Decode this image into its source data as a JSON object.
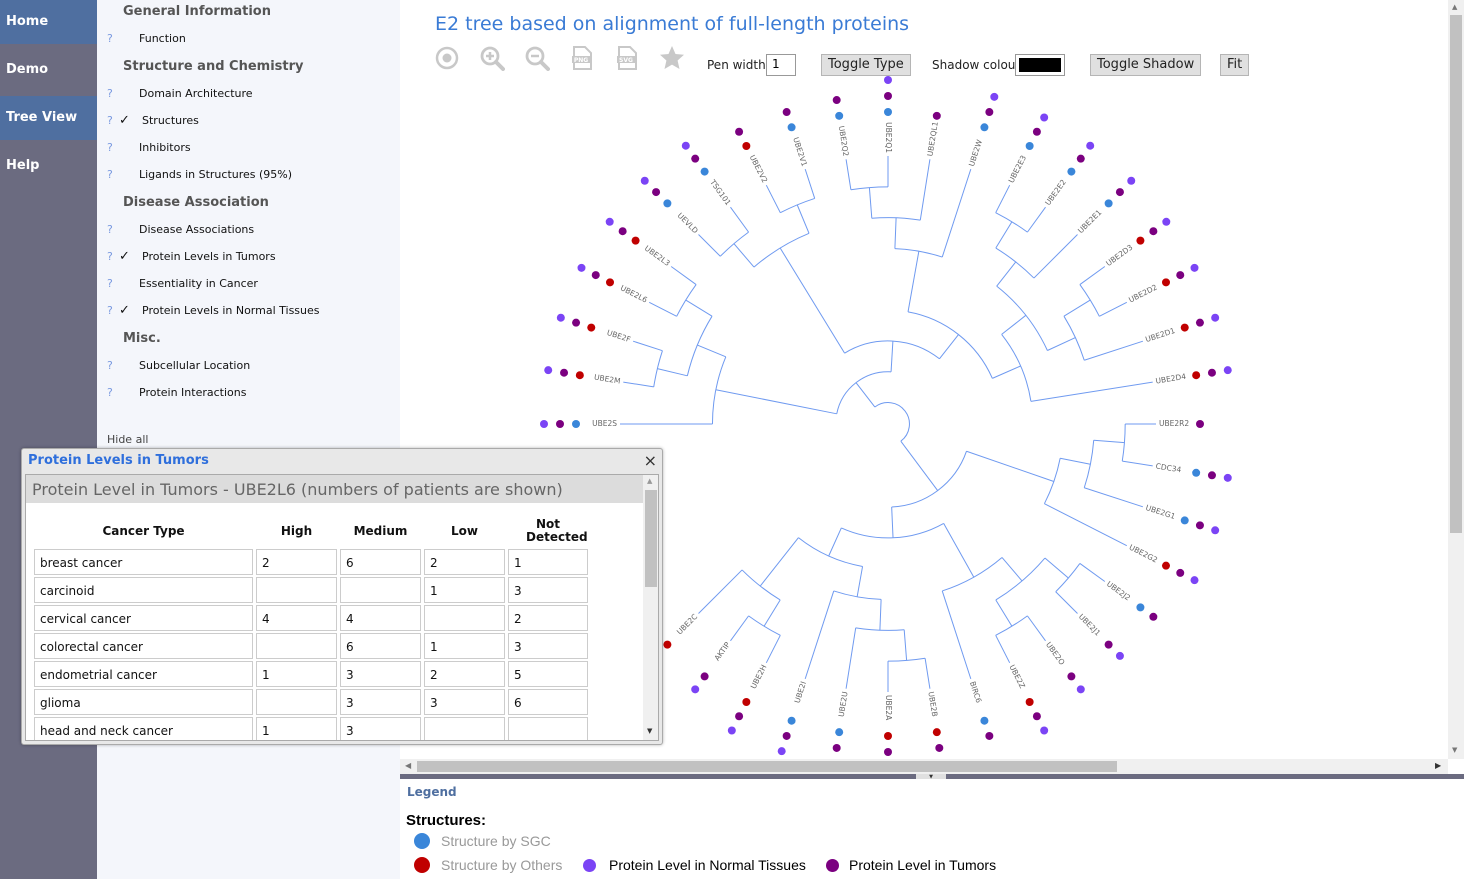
{
  "nav": {
    "items": [
      {
        "label": "Home",
        "active": true
      },
      {
        "label": "Demo",
        "active": false
      },
      {
        "label": "Tree View",
        "active": true
      },
      {
        "label": "Help",
        "active": false
      }
    ]
  },
  "panel": {
    "entries": [
      {
        "type": "section",
        "label": "General Information"
      },
      {
        "type": "item",
        "label": "Function",
        "checked": false
      },
      {
        "type": "section",
        "label": "Structure and Chemistry"
      },
      {
        "type": "item",
        "label": "Domain Architecture",
        "checked": false
      },
      {
        "type": "item",
        "label": "Structures",
        "checked": true
      },
      {
        "type": "item",
        "label": "Inhibitors",
        "checked": false
      },
      {
        "type": "item",
        "label": "Ligands in Structures (95%)",
        "checked": false
      },
      {
        "type": "section",
        "label": "Disease Association"
      },
      {
        "type": "item",
        "label": "Disease Associations",
        "checked": false
      },
      {
        "type": "item",
        "label": "Protein Levels in Tumors",
        "checked": true
      },
      {
        "type": "item",
        "label": "Essentiality in Cancer",
        "checked": false
      },
      {
        "type": "item",
        "label": "Protein Levels in Normal Tissues",
        "checked": true
      },
      {
        "type": "section",
        "label": "Misc."
      },
      {
        "type": "item",
        "label": "Subcellular Location",
        "checked": false
      },
      {
        "type": "item",
        "label": "Protein Interactions",
        "checked": false
      }
    ],
    "help_glyph": "?",
    "check_glyph": "✓",
    "hide_all": "Hide all"
  },
  "main": {
    "title": "E2 tree based on alignment of full-length proteins",
    "toolbar": {
      "icons": [
        "reset-view-icon",
        "zoom-in-icon",
        "zoom-out-icon",
        "export-png-icon",
        "export-svg-icon",
        "favorite-star-icon"
      ],
      "png": "PNG",
      "svg": "SVG",
      "pen_width_label": "Pen width",
      "pen_width": "1",
      "toggle_type": "Toggle Type",
      "shadow_colour_label": "Shadow colour",
      "shadow_colour": "#000000",
      "toggle_shadow": "Toggle Shadow",
      "fit": "Fit"
    }
  },
  "colors": {
    "branch": "#6f9af0",
    "label": "#666666",
    "sgc": "#3a86d9",
    "others": "#c00000",
    "tumor": "#7b0080",
    "normal": "#7b44f5",
    "accent": "#3a7bd5"
  },
  "tree": {
    "leaves": [
      {
        "name": "UBE2S",
        "structure": "sgc",
        "tumor": true,
        "normal": true
      },
      {
        "name": "UBE2M",
        "structure": "others",
        "tumor": true,
        "normal": true
      },
      {
        "name": "UBE2F",
        "structure": "others",
        "tumor": true,
        "normal": true
      },
      {
        "name": "UBE2L6",
        "structure": "others",
        "tumor": true,
        "normal": true
      },
      {
        "name": "UBE2L3",
        "structure": "others",
        "tumor": true,
        "normal": true
      },
      {
        "name": "UEVLD",
        "structure": "sgc",
        "tumor": true,
        "normal": true
      },
      {
        "name": "TSG101",
        "structure": "sgc",
        "tumor": true,
        "normal": true
      },
      {
        "name": "UBE2V2",
        "structure": "others",
        "tumor": true,
        "normal": false
      },
      {
        "name": "UBE2V1",
        "structure": "sgc",
        "tumor": true,
        "normal": false
      },
      {
        "name": "UBE2Q2",
        "structure": "sgc",
        "tumor": true,
        "normal": false
      },
      {
        "name": "UBE2Q1",
        "structure": "sgc",
        "tumor": true,
        "normal": true
      },
      {
        "name": "UBE2QL1",
        "structure": null,
        "tumor": true,
        "normal": false
      },
      {
        "name": "UBE2W",
        "structure": "sgc",
        "tumor": true,
        "normal": true
      },
      {
        "name": "UBE2E3",
        "structure": "sgc",
        "tumor": true,
        "normal": true
      },
      {
        "name": "UBE2E2",
        "structure": "sgc",
        "tumor": true,
        "normal": true
      },
      {
        "name": "UBE2E1",
        "structure": "sgc",
        "tumor": true,
        "normal": true
      },
      {
        "name": "UBE2D3",
        "structure": "others",
        "tumor": true,
        "normal": true
      },
      {
        "name": "UBE2D2",
        "structure": "others",
        "tumor": true,
        "normal": true
      },
      {
        "name": "UBE2D1",
        "structure": "others",
        "tumor": true,
        "normal": true
      },
      {
        "name": "UBE2D4",
        "structure": "others",
        "tumor": true,
        "normal": true
      },
      {
        "name": "UBE2R2",
        "structure": null,
        "tumor": true,
        "normal": false
      },
      {
        "name": "CDC34",
        "structure": "sgc",
        "tumor": true,
        "normal": true
      },
      {
        "name": "UBE2G1",
        "structure": "sgc",
        "tumor": true,
        "normal": true
      },
      {
        "name": "UBE2G2",
        "structure": "others",
        "tumor": true,
        "normal": true
      },
      {
        "name": "UBE2J2",
        "structure": "sgc",
        "tumor": true,
        "normal": false
      },
      {
        "name": "UBE2J1",
        "structure": null,
        "tumor": true,
        "normal": true
      },
      {
        "name": "UBE2O",
        "structure": null,
        "tumor": true,
        "normal": true
      },
      {
        "name": "UBE2Z",
        "structure": "others",
        "tumor": true,
        "normal": true
      },
      {
        "name": "BIRC6",
        "structure": "sgc",
        "tumor": true,
        "normal": false
      },
      {
        "name": "UBE2B",
        "structure": "others",
        "tumor": true,
        "normal": false
      },
      {
        "name": "UBE2A",
        "structure": "others",
        "tumor": true,
        "normal": false
      },
      {
        "name": "UBE2U",
        "structure": "sgc",
        "tumor": true,
        "normal": false
      },
      {
        "name": "UBE2I",
        "structure": "sgc",
        "tumor": true,
        "normal": true
      },
      {
        "name": "UBE2H",
        "structure": "others",
        "tumor": true,
        "normal": true
      },
      {
        "name": "AKTIP",
        "structure": null,
        "tumor": true,
        "normal": true
      },
      {
        "name": "UBE2C",
        "structure": "others",
        "tumor": false,
        "normal": false
      }
    ],
    "topology": [
      [
        [
          "UBE2S",
          [
            [
              "UBE2M",
              "UBE2F"
            ],
            [
              "UBE2L6",
              "UBE2L3"
            ]
          ]
        ],
        [
          [
            [
              "UEVLD",
              "TSG101"
            ],
            [
              "UBE2V2",
              "UBE2V1"
            ]
          ],
          [
            [
              [
                [
                  "UBE2Q2",
                  "UBE2Q1"
                ],
                "UBE2QL1"
              ],
              "UBE2W"
            ],
            [
              [
                [
                  [
                    "UBE2E3",
                    "UBE2E2"
                  ],
                  "UBE2E1"
                ],
                [
                  [
                    "UBE2D3",
                    "UBE2D2"
                  ],
                  "UBE2D1"
                ]
              ],
              "UBE2D4"
            ]
          ]
        ]
      ],
      [
        [
          [
            [
              "UBE2R2",
              "CDC34"
            ],
            "UBE2G1"
          ],
          "UBE2G2"
        ],
        [
          [
            [
              [
                "UBE2J2",
                "UBE2J1"
              ],
              [
                "UBE2O",
                "UBE2Z"
              ]
            ],
            "BIRC6"
          ],
          [
            [
              [
                [
                  "UBE2B",
                  "UBE2A"
                ],
                "UBE2U"
              ],
              "UBE2I"
            ],
            [
              [
                "UBE2H",
                "AKTIP"
              ],
              "UBE2C"
            ]
          ]
        ]
      ]
    ]
  },
  "popup": {
    "title": "Protein Levels in Tumors",
    "close": "×",
    "subtitle": "Protein Level in Tumors - UBE2L6 (numbers of patients are shown)",
    "columns": [
      "Cancer Type",
      "High",
      "Medium",
      "Low",
      "Not Detected"
    ],
    "rows": [
      [
        "breast cancer",
        "2",
        "6",
        "2",
        "1"
      ],
      [
        "carcinoid",
        "",
        "",
        "1",
        "3"
      ],
      [
        "cervical cancer",
        "4",
        "4",
        "",
        "2"
      ],
      [
        "colorectal cancer",
        "",
        "6",
        "1",
        "3"
      ],
      [
        "endometrial cancer",
        "1",
        "3",
        "2",
        "5"
      ],
      [
        "glioma",
        "",
        "3",
        "3",
        "6"
      ],
      [
        "head and neck cancer",
        "1",
        "3",
        "",
        ""
      ]
    ]
  },
  "legend": {
    "title": "Legend",
    "structures_heading": "Structures:",
    "sgc": "Structure by SGC",
    "others": "Structure by Others",
    "normal": "Protein Level in Normal Tissues",
    "tumor": "Protein Level in Tumors"
  }
}
